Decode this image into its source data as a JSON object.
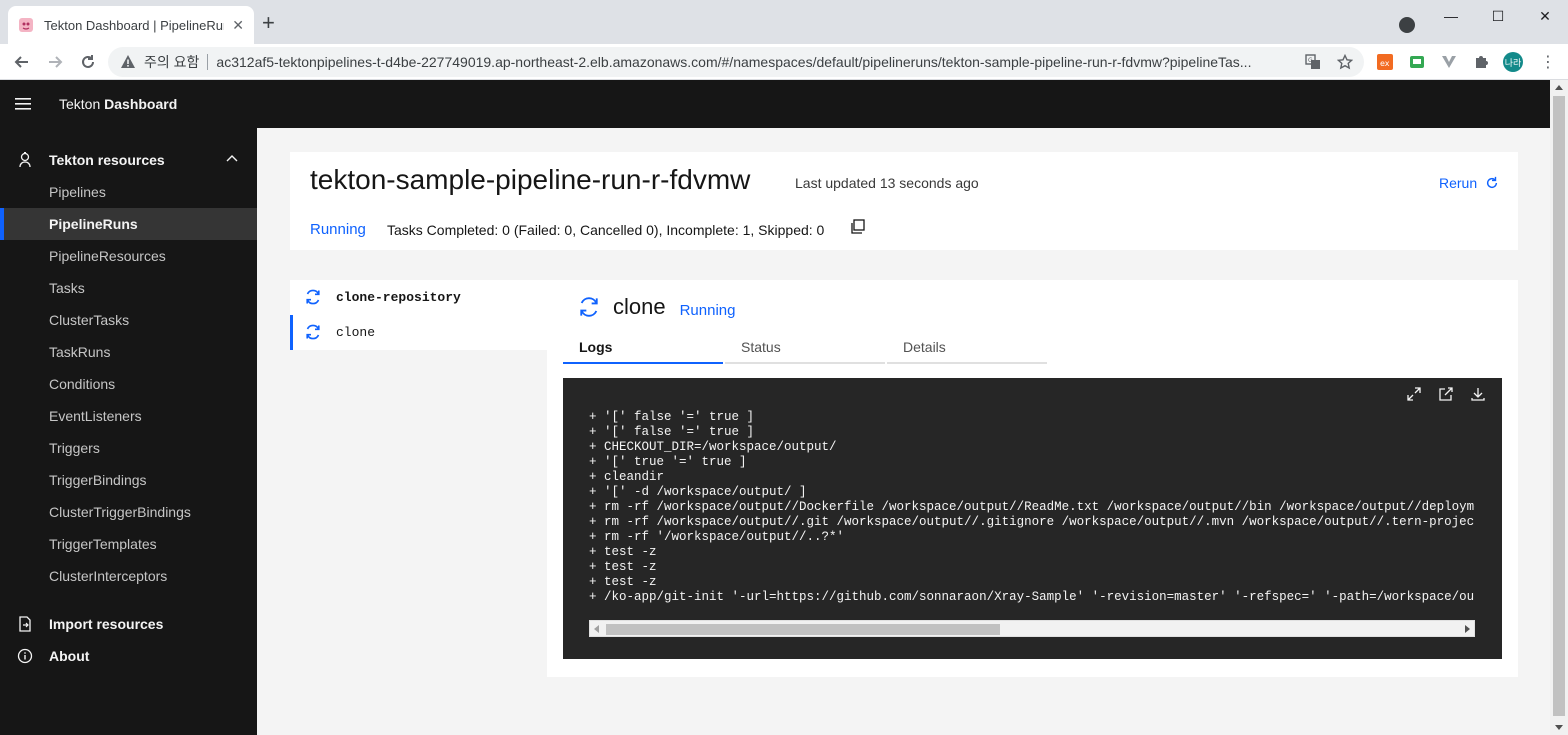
{
  "browser": {
    "tab_title": "Tekton Dashboard | PipelineRuns",
    "tab_close": "✕",
    "new_tab": "+",
    "security_warning": "주의 요함",
    "url": "ac312af5-tektonpipelines-t-d4be-227749019.ap-northeast-2.elb.amazonaws.com/#/namespaces/default/pipelineruns/tekton-sample-pipeline-run-r-fdvmw?pipelineTas...",
    "avatar_text": "나라",
    "window_minimize": "—",
    "window_maximize": "☐",
    "window_close": "✕"
  },
  "app": {
    "brand_prefix": "Tekton ",
    "brand_name": "Dashboard"
  },
  "sidebar": {
    "section_title": "Tekton resources",
    "items": [
      {
        "label": "Pipelines"
      },
      {
        "label": "PipelineRuns",
        "active": true
      },
      {
        "label": "PipelineResources"
      },
      {
        "label": "Tasks"
      },
      {
        "label": "ClusterTasks"
      },
      {
        "label": "TaskRuns"
      },
      {
        "label": "Conditions"
      },
      {
        "label": "EventListeners"
      },
      {
        "label": "Triggers"
      },
      {
        "label": "TriggerBindings"
      },
      {
        "label": "ClusterTriggerBindings"
      },
      {
        "label": "TriggerTemplates"
      },
      {
        "label": "ClusterInterceptors"
      }
    ],
    "import_label": "Import resources",
    "about_label": "About"
  },
  "pipeline_run": {
    "name": "tekton-sample-pipeline-run-r-fdvmw",
    "last_updated": "Last updated 13 seconds ago",
    "rerun_label": "Rerun",
    "status": "Running",
    "tasks_summary": "Tasks Completed: 0 (Failed: 0, Cancelled 0), Incomplete: 1, Skipped: 0"
  },
  "task_tree": {
    "task_name": "clone-repository",
    "step_name": "clone"
  },
  "step": {
    "name": "clone",
    "status": "Running",
    "tabs": [
      "Logs",
      "Status",
      "Details"
    ],
    "active_tab": "Logs"
  },
  "logs": {
    "lines": [
      "+ '[' false '=' true ]",
      "+ '[' false '=' true ]",
      "+ CHECKOUT_DIR=/workspace/output/",
      "+ '[' true '=' true ]",
      "+ cleandir",
      "+ '[' -d /workspace/output/ ]",
      "+ rm -rf /workspace/output//Dockerfile /workspace/output//ReadMe.txt /workspace/output//bin /workspace/output//deployment",
      "+ rm -rf /workspace/output//.git /workspace/output//.gitignore /workspace/output//.mvn /workspace/output//.tern-project",
      "+ rm -rf '/workspace/output//..?*'",
      "+ test -z",
      "+ test -z",
      "+ test -z",
      "+ /ko-app/git-init '-url=https://github.com/sonnaraon/Xray-Sample' '-revision=master' '-refspec=' '-path=/workspace/outpu"
    ]
  },
  "colors": {
    "accent": "#0f62fe",
    "shell_dark": "#161616",
    "log_bg": "#262626"
  }
}
